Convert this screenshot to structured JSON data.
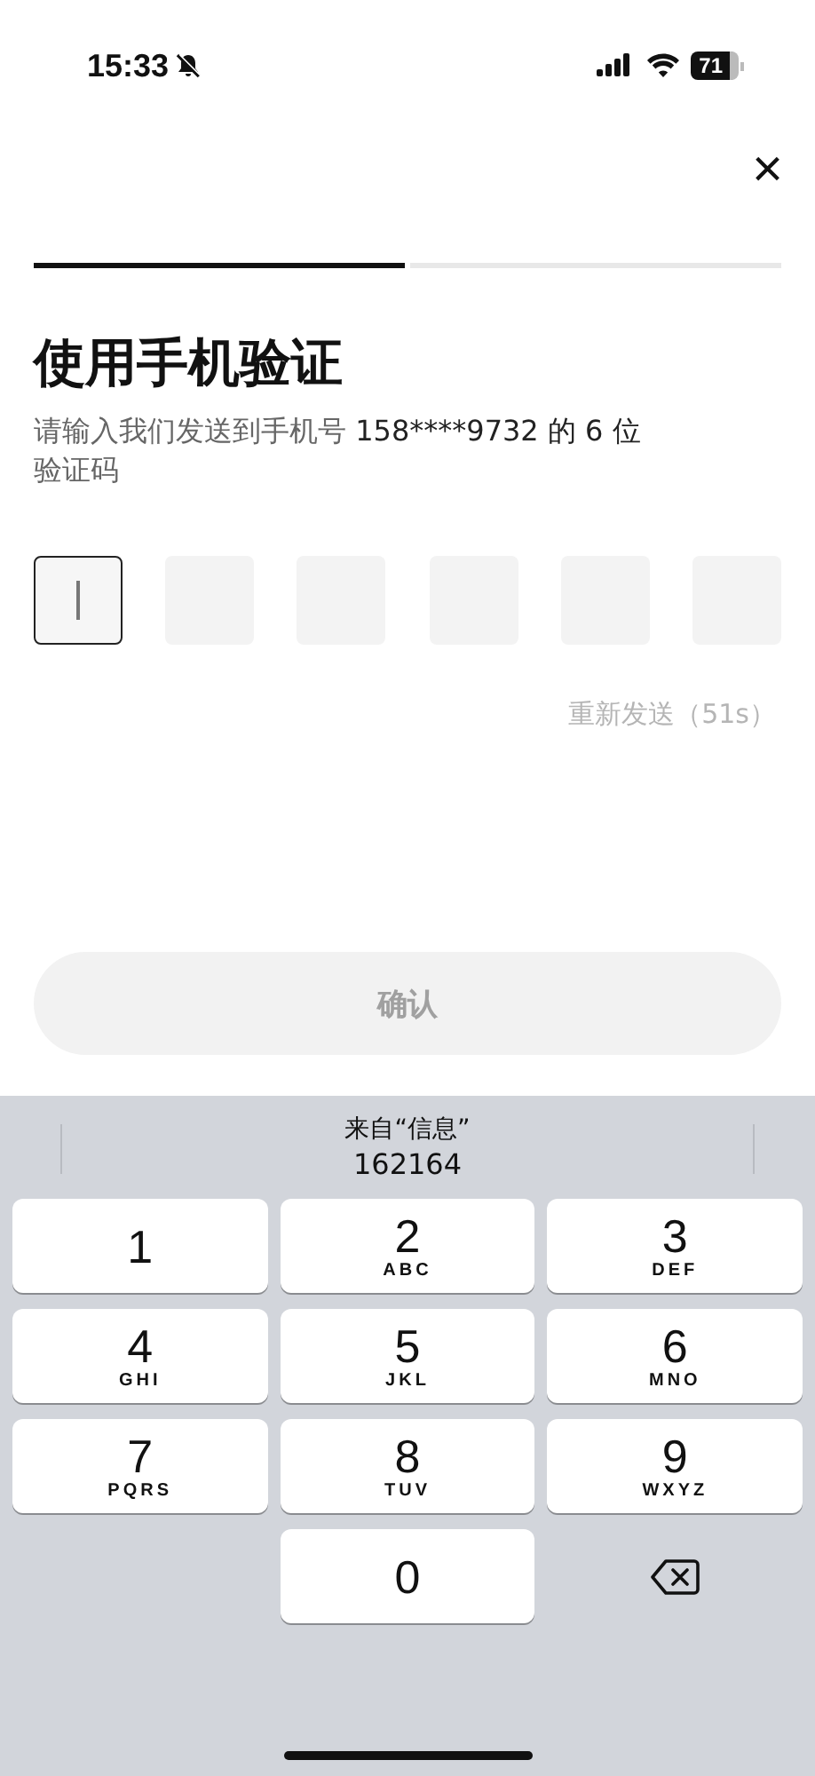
{
  "status_bar": {
    "time": "15:33",
    "silent": true,
    "battery": "71"
  },
  "close": "×",
  "progress": [
    {
      "done": true
    },
    {
      "done": false
    }
  ],
  "title": "使用手机验证",
  "subtitle": {
    "prefix": "请输入我们发送到手机号 ",
    "phone": "158****9732 的 6 位",
    "suffix": "验证码"
  },
  "code_boxes": [
    {
      "selected": true
    },
    {
      "selected": false
    },
    {
      "selected": false
    },
    {
      "selected": false
    },
    {
      "selected": false
    },
    {
      "selected": false
    }
  ],
  "resend": "重新发送（51s）",
  "confirm": {
    "label": "确认",
    "disabled": true
  },
  "suggestion": {
    "source": "来自“信息”",
    "code": "162164"
  },
  "keys": [
    {
      "kind": "key",
      "digit": "1"
    },
    {
      "kind": "key",
      "digit": "2",
      "letters": "ABC"
    },
    {
      "kind": "key",
      "digit": "3",
      "letters": "DEF"
    },
    {
      "kind": "key",
      "digit": "4",
      "letters": "GHI"
    },
    {
      "kind": "key",
      "digit": "5",
      "letters": "JKL"
    },
    {
      "kind": "key",
      "digit": "6",
      "letters": "MNO"
    },
    {
      "kind": "key",
      "digit": "7",
      "letters": "PQRS"
    },
    {
      "kind": "key",
      "digit": "8",
      "letters": "TUV"
    },
    {
      "kind": "key",
      "digit": "9",
      "letters": "WXYZ"
    },
    {
      "kind": "blank"
    },
    {
      "kind": "key",
      "digit": "0"
    },
    {
      "kind": "delete"
    }
  ]
}
